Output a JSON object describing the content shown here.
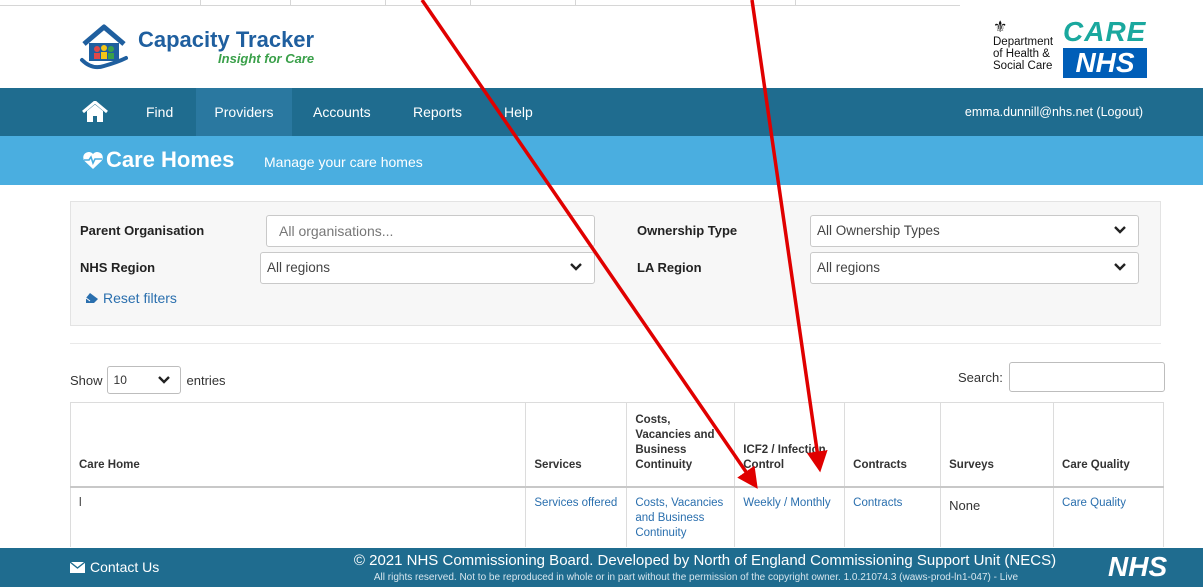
{
  "app": {
    "name": "Capacity Tracker",
    "tagline": "Insight for Care"
  },
  "header": {
    "dhsc_lines": [
      "Department",
      "of Health &",
      "Social Care"
    ],
    "care_label": "CARE",
    "nhs_label": "NHS"
  },
  "nav": {
    "items": [
      {
        "label": "Find"
      },
      {
        "label": "Providers",
        "active": true
      },
      {
        "label": "Accounts"
      },
      {
        "label": "Reports"
      },
      {
        "label": "Help"
      }
    ],
    "user": "emma.dunnill@nhs.net (Logout)"
  },
  "banner": {
    "title": "Care Homes",
    "subtitle": "Manage your care homes"
  },
  "filters": {
    "parent_org": {
      "label": "Parent Organisation",
      "placeholder": "All organisations..."
    },
    "ownership": {
      "label": "Ownership Type",
      "value": "All Ownership Types"
    },
    "nhs_region": {
      "label": "NHS Region",
      "value": "All regions"
    },
    "la_region": {
      "label": "LA Region",
      "value": "All regions"
    },
    "reset_label": "Reset filters"
  },
  "table_controls": {
    "show_label": "Show",
    "entries_value": "10",
    "entries_label": "entries",
    "search_label": "Search:"
  },
  "table": {
    "columns": [
      "Care Home",
      "Services",
      "Costs, Vacancies and Business Continuity",
      "ICF2 / Infection Control",
      "Contracts",
      "Surveys",
      "Care Quality"
    ],
    "rows": [
      {
        "care_home": "l",
        "services": "Services offered",
        "costs": "Costs, Vacancies and Business Continuity",
        "icf_weekly": "Weekly",
        "icf_sep": " / ",
        "icf_monthly": "Monthly",
        "contracts": "Contracts",
        "surveys": "None",
        "care_quality": "Care Quality"
      }
    ]
  },
  "footer": {
    "contact": "Contact Us",
    "copyright": "© 2021 NHS Commissioning Board. Developed by North of England Commissioning Support Unit (NECS)",
    "rights": "All rights reserved. Not to be reproduced in whole or in part without the permission of the copyright owner. 1.0.21074.3 (waws-prod-ln1-047) - Live",
    "nhs_logo": "NHS"
  },
  "colors": {
    "nav_bg": "#1f6c8f",
    "banner_bg": "#4aaee0",
    "link": "#2a6fae",
    "annotation": "#e00000"
  }
}
